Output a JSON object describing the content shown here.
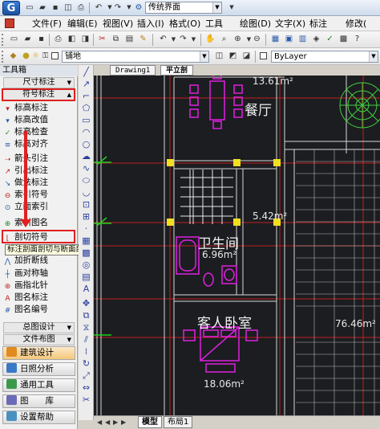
{
  "titlebar": {
    "logo_letter": "G",
    "workspace": "传统界面"
  },
  "menu": {
    "items": [
      "文件(F)",
      "编辑(E)",
      "视图(V)",
      "插入(I)",
      "格式(O)",
      "工具",
      "绘图(D)",
      "文字(X)",
      "标注",
      "修改("
    ]
  },
  "layer_bar": {
    "layer_name": "铺地",
    "bylayer": "ByLayer"
  },
  "left_panel": {
    "title": "工具箱",
    "categories": {
      "dimension": "尺寸标注",
      "symbol": "符号标注",
      "plan": "总图设计",
      "file": "文件布图"
    },
    "items": [
      {
        "label": "标高标注",
        "icon": "elevation-mark-icon"
      },
      {
        "label": "标高改值",
        "icon": "elevation-edit-icon"
      },
      {
        "label": "标高检查",
        "icon": "elevation-check-icon"
      },
      {
        "label": "标高对齐",
        "icon": "elevation-align-icon"
      },
      {
        "label": "箭头引注",
        "icon": "arrow-note-icon"
      },
      {
        "label": "引出标注",
        "icon": "leader-note-icon"
      },
      {
        "label": "做法标注",
        "icon": "method-note-icon"
      },
      {
        "label": "索引符号",
        "icon": "index-symbol-icon"
      },
      {
        "label": "立面索引",
        "icon": "elevation-index-icon"
      },
      {
        "label": "索引图名",
        "icon": "index-title-icon"
      },
      {
        "label": "剖切符号",
        "icon": "section-symbol-icon"
      },
      {
        "label": "加折断线",
        "icon": "break-line-icon"
      },
      {
        "label": "画对称轴",
        "icon": "symmetry-axis-icon"
      },
      {
        "label": "画指北针",
        "icon": "north-arrow-icon"
      },
      {
        "label": "图名标注",
        "icon": "drawing-name-icon"
      },
      {
        "label": "图名编号",
        "icon": "drawing-number-icon"
      }
    ],
    "tooltip": "标注剖面剖切与断面剖切符号[PQFH]",
    "modules": [
      {
        "label": "建筑设计",
        "color": "#e08a20"
      },
      {
        "label": "日照分析",
        "color": "#3a78c8"
      },
      {
        "label": "通用工具",
        "color": "#3a9a4a"
      },
      {
        "label": "图　　库",
        "color": "#6a6ab8"
      },
      {
        "label": "设置帮助",
        "color": "#4a90c0"
      }
    ]
  },
  "drawing": {
    "tabs": [
      "Drawing1",
      "平立剖"
    ],
    "rooms": [
      {
        "name": "餐厅",
        "area": "13.61m²"
      },
      {
        "name": "卫生间",
        "area": "6.96m²"
      },
      {
        "name": "客人卧室",
        "area": "18.06m²"
      }
    ],
    "other_areas": [
      "5.42m²",
      "76.46m²"
    ]
  },
  "bottom_tabs": [
    "模型",
    "布局1"
  ]
}
